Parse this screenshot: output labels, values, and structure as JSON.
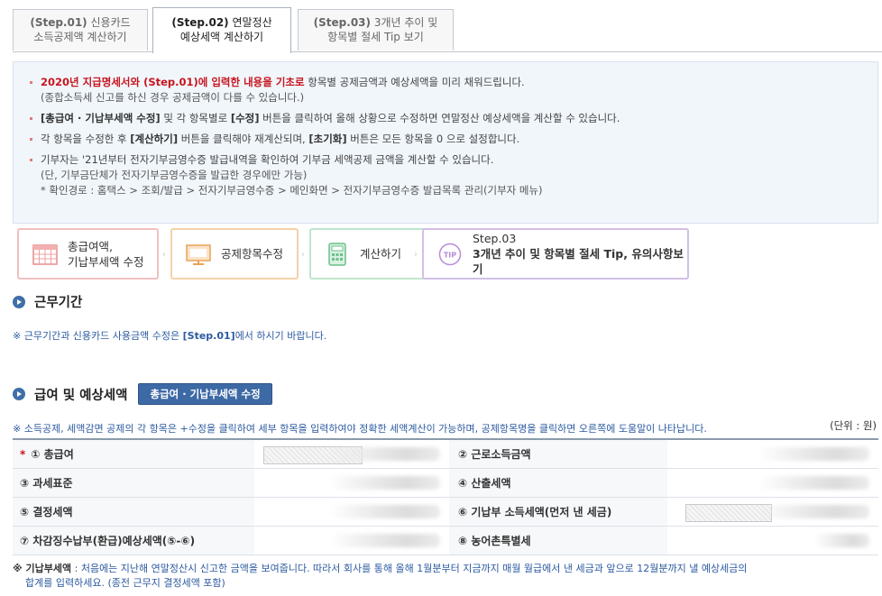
{
  "tabs": [
    {
      "step": "(Step.01)",
      "label1": "신용카드",
      "label2": "소득공제액 계산하기"
    },
    {
      "step": "(Step.02)",
      "label1": "연말정산",
      "label2": "예상세액 계산하기"
    },
    {
      "step": "(Step.03)",
      "label1": "3개년 추이 및",
      "label2": "항목별 절세 Tip 보기"
    }
  ],
  "info": {
    "line1_red": "2020년 지급명세서와 (Step.01)에 입력한 내용을 기초로",
    "line1_rest": " 항목별 공제금액과 예상세액을 미리 채워드립니다.",
    "line1_sub": "(종합소득세 신고를 하신 경우 공제금액이 다를 수 있습니다.)",
    "line2_b1": "[총급여 · 기납부세액 수정]",
    "line2_t1": " 및 각 항목별로 ",
    "line2_b2": "[수정]",
    "line2_t2": " 버튼을 클릭하여 올해 상황으로 수정하면 연말정산 예상세액을 계산할 수 있습니다.",
    "line3_t1": "각 항목을 수정한 후 ",
    "line3_b1": "[계산하기]",
    "line3_t2": " 버튼을 클릭해야 재계산되며, ",
    "line3_b2": "[초기화]",
    "line3_t3": " 버튼은 모든 항목을 0 으로 설정합니다.",
    "line4": "기부자는 '21년부터 전자기부금영수증 발급내역을 확인하여 기부금 세액공제 금액을 계산할 수 있습니다.",
    "line4_sub1": "(단, 기부금단체가 전자기부금영수증을 발급한 경우에만 가능)",
    "line4_sub2": "* 확인경로 : 홈택스 > 조회/발급 > 전자기부금영수증 > 메인화면 > 전자기부금영수증 발급목록 관리(기부자 메뉴)"
  },
  "steps": {
    "s1_l1": "총급여액,",
    "s1_l2": "기납부세액 수정",
    "s2": "공제항목수정",
    "s3": "계산하기",
    "s4_tip": "TIP",
    "s4_l1": "Step.03",
    "s4_l2": "3개년 추이 및 항목별 절세 Tip, 유의사항보기"
  },
  "work_period": {
    "title": "근무기간",
    "note_prefix": "※ 근무기간과 신용카드 사용금액 수정은 ",
    "note_bold": "[Step.01]",
    "note_suffix": "에서 하시기 바랍니다."
  },
  "salary": {
    "title": "급여 및 예상세액",
    "edit_button": "총급여 · 기납부세액 수정",
    "note": "※ 소득공제, 세액감면 공제의 각 항목은 +수정을 클릭하여 세부 항목을 입력하여야 정확한 세액계산이 가능하며, 공제항목명을 클릭하면 오른쪽에 도움말이 나타납니다.",
    "unit": "(단위 : 원)",
    "rows": [
      {
        "l": "① 총급여",
        "r": "② 근로소득금액"
      },
      {
        "l": "③ 과세표준",
        "r": "④ 산출세액"
      },
      {
        "l": "⑤ 결정세액",
        "r": "⑥ 기납부 소득세액(먼저 낸 세금)"
      },
      {
        "l": "⑦ 차감징수납부(환급)예상세액(⑤-⑥)",
        "r": "⑧ 농어촌특별세"
      }
    ],
    "required_mark": "*"
  },
  "footnote": {
    "bold": "※ 기납부세액",
    "text": " : 처음에는 지난해 연말정산시 신고한 금액을 보여줍니다. 따라서 회사를 통해 올해 1월분부터 지금까지 매월 월급에서 낸 세금과 앞으로 12월분까지 낼 예상세금의",
    "text2": "합계를 입력하세요. (종전 근무지 결정세액 포함)"
  }
}
